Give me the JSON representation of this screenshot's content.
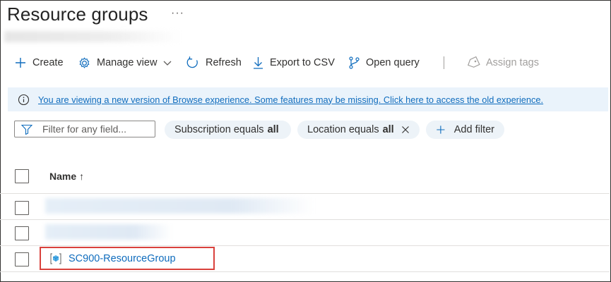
{
  "page": {
    "title": "Resource groups",
    "more_label": "···"
  },
  "toolbar": {
    "create": "Create",
    "manage_view": "Manage view",
    "refresh": "Refresh",
    "export_csv": "Export to CSV",
    "open_query": "Open query",
    "assign_tags": "Assign tags"
  },
  "banner": {
    "text": "You are viewing a new version of Browse experience. Some features may be missing. Click here to access the old experience."
  },
  "filters": {
    "placeholder": "Filter for any field...",
    "subscription_label": "Subscription equals",
    "subscription_value": "all",
    "location_label": "Location equals",
    "location_value": "all",
    "add_filter": "Add filter"
  },
  "table": {
    "column_name": "Name",
    "sort_indicator": "↑",
    "rows": [
      {
        "name": ""
      },
      {
        "name": ""
      },
      {
        "name": "SC900-ResourceGroup"
      }
    ]
  },
  "colors": {
    "accent": "#0f6cbd",
    "highlight": "#d9413c",
    "banner": "#eaf3fb",
    "pill": "#edf3f8"
  }
}
